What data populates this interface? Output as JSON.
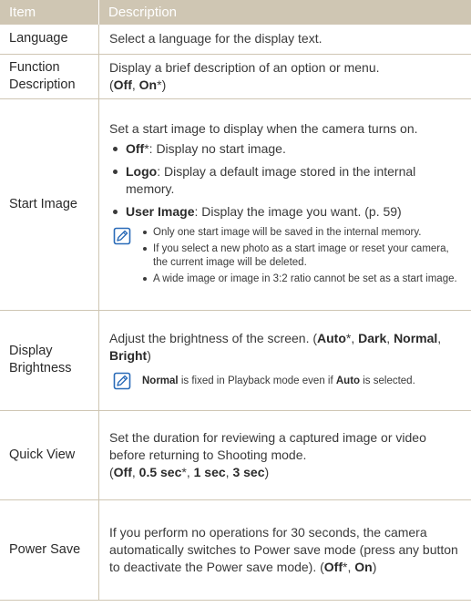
{
  "header": {
    "item": "Item",
    "description": "Description"
  },
  "rows": {
    "language": {
      "item": "Language",
      "desc": "Select a language for the display text."
    },
    "function": {
      "item": "Function Description",
      "desc": "Display a brief description of an option or menu.",
      "opt_open": "(",
      "opt1": "Off",
      "sep": ", ",
      "opt2": "On",
      "opt_close": "*)"
    },
    "start_image": {
      "item": "Start Image",
      "desc": "Set a start image to display when the camera turns on.",
      "options": [
        {
          "name": "Off",
          "text": "*: Display no start image."
        },
        {
          "name": "Logo",
          "text": ": Display a default image stored in the internal memory."
        },
        {
          "name": "User Image",
          "text": ": Display the image you want. (p. 59)"
        }
      ],
      "notes": [
        "Only one start image will be saved in the internal memory.",
        "If you select a new photo as a start image or reset your camera, the current image will be deleted.",
        "A wide image or image in 3:2 ratio cannot be set as a start image."
      ]
    },
    "brightness": {
      "item": "Display Brightness",
      "desc": "Adjust the brightness of the screen. (",
      "o1": "Auto",
      "o1s": "*, ",
      "o2": "Dark",
      "o2s": ", ",
      "o3": "Normal",
      "o3s": ", ",
      "o4": "Bright",
      "close": ")",
      "note_b1": "Normal",
      "note_t1": " is fixed in Playback mode even if ",
      "note_b2": "Auto",
      "note_t2": " is selected."
    },
    "quick_view": {
      "item": "Quick View",
      "desc": "Set the duration for reviewing a captured image or video before returning to Shooting mode.",
      "open": "(",
      "o1": "Off",
      "s1": ", ",
      "o2": "0.5 sec",
      "s2": "*, ",
      "o3": "1 sec",
      "s3": ", ",
      "o4": "3 sec",
      "close": ")"
    },
    "power_save": {
      "item": "Power Save",
      "desc": "If you perform no operations for 30 seconds, the camera automatically switches to Power save mode (press any button to deactivate the Power save mode). (",
      "o1": "Off",
      "s1": "*, ",
      "o2": "On",
      "close": ")"
    }
  },
  "colors": {
    "header_bg": "#cfc6b3",
    "border": "#cfc6b3",
    "note_icon": "#2a6bb8"
  },
  "icons": {
    "note": "note-pencil-icon"
  }
}
